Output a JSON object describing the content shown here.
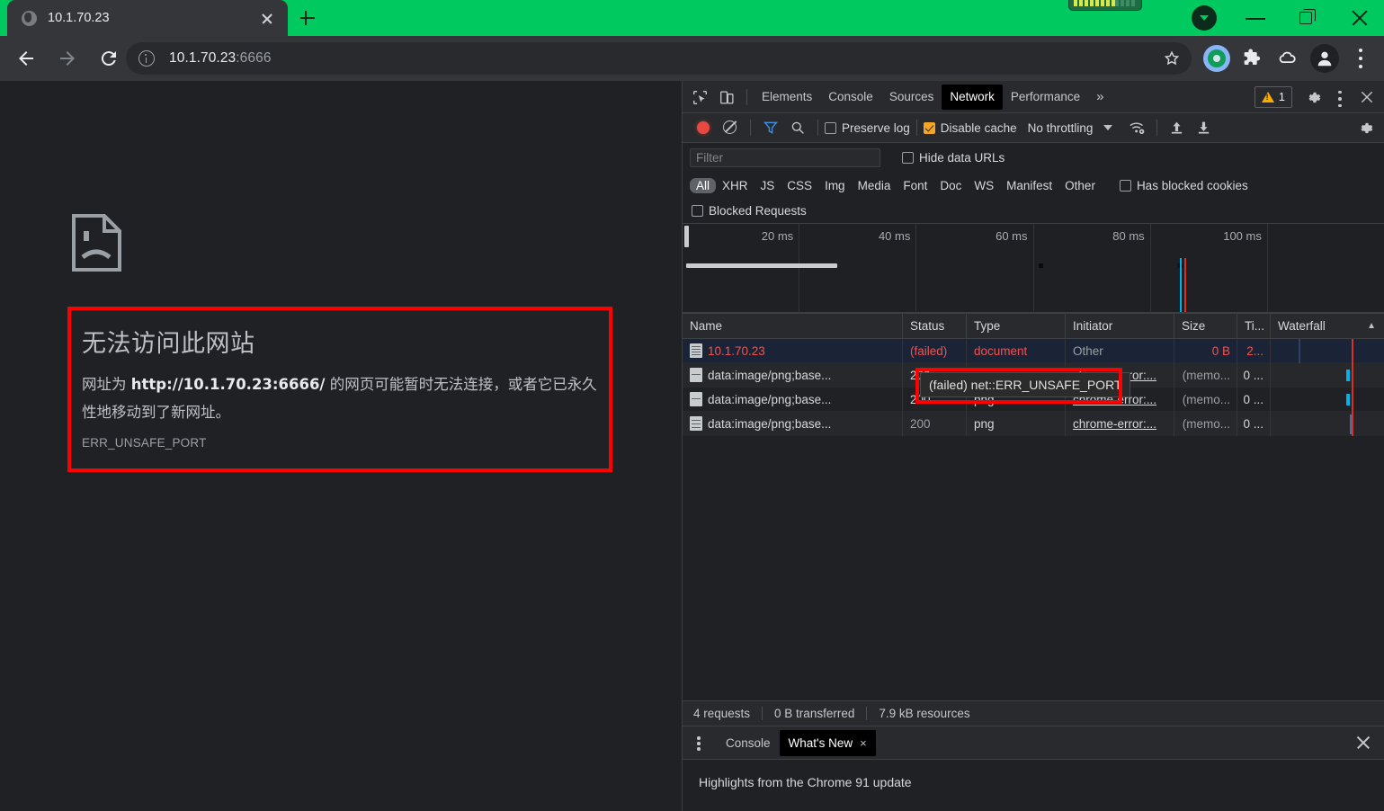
{
  "browser": {
    "tab": {
      "title": "10.1.70.23",
      "close_label": "×"
    },
    "new_tab_label": "+",
    "omnibox": {
      "host": "10.1.70.23",
      "port": ":6666",
      "full": "10.1.70.23:6666"
    },
    "window_controls": {
      "minimize": "—",
      "maximize": "❐",
      "close": "✕"
    }
  },
  "error_page": {
    "heading": "无法访问此网站",
    "body_pre": "网址为 ",
    "body_url": "http://10.1.70.23:6666/",
    "body_post": " 的网页可能暂时无法连接，或者它已永久性地移动到了新网址。",
    "code": "ERR_UNSAFE_PORT"
  },
  "devtools": {
    "panel_tabs": [
      {
        "label": "Elements",
        "active": false
      },
      {
        "label": "Console",
        "active": false
      },
      {
        "label": "Sources",
        "active": false
      },
      {
        "label": "Network",
        "active": true
      },
      {
        "label": "Performance",
        "active": false
      }
    ],
    "more_tabs_label": "»",
    "warning_count": "1",
    "action_row": {
      "preserve_log": {
        "label": "Preserve log",
        "checked": false
      },
      "disable_cache": {
        "label": "Disable cache",
        "checked": true
      },
      "throttling": "No throttling"
    },
    "filter": {
      "placeholder": "Filter",
      "value": ""
    },
    "hide_data_urls": {
      "label": "Hide data URLs",
      "checked": false
    },
    "type_filters": [
      {
        "label": "All",
        "selected": true
      },
      {
        "label": "XHR",
        "selected": false
      },
      {
        "label": "JS",
        "selected": false
      },
      {
        "label": "CSS",
        "selected": false
      },
      {
        "label": "Img",
        "selected": false
      },
      {
        "label": "Media",
        "selected": false
      },
      {
        "label": "Font",
        "selected": false
      },
      {
        "label": "Doc",
        "selected": false
      },
      {
        "label": "WS",
        "selected": false
      },
      {
        "label": "Manifest",
        "selected": false
      },
      {
        "label": "Other",
        "selected": false
      }
    ],
    "has_blocked_cookies": {
      "label": "Has blocked cookies",
      "checked": false
    },
    "blocked_requests": {
      "label": "Blocked Requests",
      "checked": false
    },
    "timeline_ticks": [
      "20 ms",
      "40 ms",
      "60 ms",
      "80 ms",
      "100 ms"
    ],
    "columns": [
      "Name",
      "Status",
      "Type",
      "Initiator",
      "Size",
      "Ti...",
      "Waterfall"
    ],
    "sort_indicator": "▲",
    "rows": [
      {
        "name": "10.1.70.23",
        "status": "(failed)",
        "type": "document",
        "initiator": "Other",
        "size": "0 B",
        "time": "2...",
        "failed": true,
        "selected": true
      },
      {
        "name": "data:image/png;base...",
        "status": "200",
        "type": "png",
        "initiator": "chrome-error:...",
        "size": "(memo...",
        "time": "0 ...",
        "failed": false,
        "selected": false
      },
      {
        "name": "data:image/png;base...",
        "status": "200",
        "type": "png",
        "initiator": "chrome-error:...",
        "size": "(memo...",
        "time": "0 ...",
        "failed": false,
        "selected": false
      },
      {
        "name": "data:image/png;base...",
        "status": "200",
        "type": "png",
        "initiator": "chrome-error:...",
        "size": "(memo...",
        "time": "0 ...",
        "failed": false,
        "selected": false
      }
    ],
    "tooltip": "(failed) net::ERR_UNSAFE_PORT",
    "status_bar": {
      "requests": "4 requests",
      "transferred": "0 B transferred",
      "resources": "7.9 kB resources"
    },
    "drawer": {
      "tabs": [
        {
          "label": "Console",
          "active": false,
          "closable": false
        },
        {
          "label": "What's New",
          "active": true,
          "closable": true
        }
      ],
      "close_label": "×",
      "content": "Highlights from the Chrome 91 update"
    }
  },
  "colors": {
    "brand_green": "#00c95f",
    "annotation_red": "#fe0000",
    "error_red": "#ef5350",
    "accent_blue": "#00b3e6",
    "warning_amber": "#f9ab00"
  }
}
